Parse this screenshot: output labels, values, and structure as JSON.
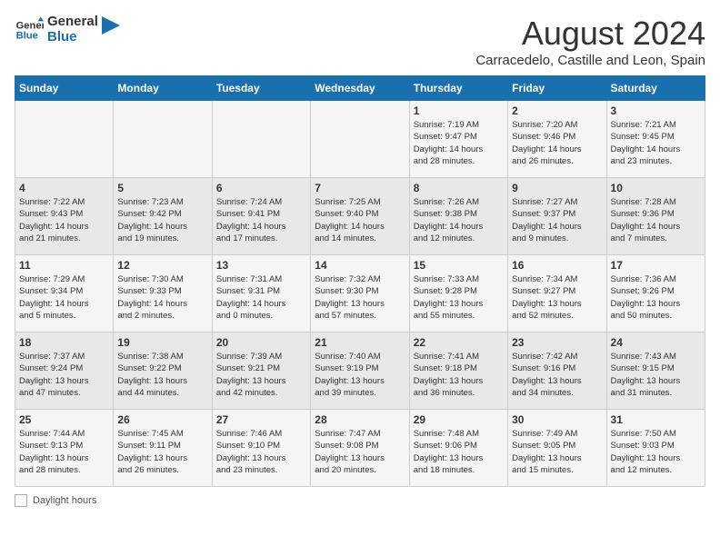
{
  "header": {
    "logo_text_general": "General",
    "logo_text_blue": "Blue",
    "month_year": "August 2024",
    "location": "Carracedelo, Castille and Leon, Spain"
  },
  "weekdays": [
    "Sunday",
    "Monday",
    "Tuesday",
    "Wednesday",
    "Thursday",
    "Friday",
    "Saturday"
  ],
  "weeks": [
    [
      {
        "day": "",
        "info": ""
      },
      {
        "day": "",
        "info": ""
      },
      {
        "day": "",
        "info": ""
      },
      {
        "day": "",
        "info": ""
      },
      {
        "day": "1",
        "info": "Sunrise: 7:19 AM\nSunset: 9:47 PM\nDaylight: 14 hours\nand 28 minutes."
      },
      {
        "day": "2",
        "info": "Sunrise: 7:20 AM\nSunset: 9:46 PM\nDaylight: 14 hours\nand 26 minutes."
      },
      {
        "day": "3",
        "info": "Sunrise: 7:21 AM\nSunset: 9:45 PM\nDaylight: 14 hours\nand 23 minutes."
      }
    ],
    [
      {
        "day": "4",
        "info": "Sunrise: 7:22 AM\nSunset: 9:43 PM\nDaylight: 14 hours\nand 21 minutes."
      },
      {
        "day": "5",
        "info": "Sunrise: 7:23 AM\nSunset: 9:42 PM\nDaylight: 14 hours\nand 19 minutes."
      },
      {
        "day": "6",
        "info": "Sunrise: 7:24 AM\nSunset: 9:41 PM\nDaylight: 14 hours\nand 17 minutes."
      },
      {
        "day": "7",
        "info": "Sunrise: 7:25 AM\nSunset: 9:40 PM\nDaylight: 14 hours\nand 14 minutes."
      },
      {
        "day": "8",
        "info": "Sunrise: 7:26 AM\nSunset: 9:38 PM\nDaylight: 14 hours\nand 12 minutes."
      },
      {
        "day": "9",
        "info": "Sunrise: 7:27 AM\nSunset: 9:37 PM\nDaylight: 14 hours\nand 9 minutes."
      },
      {
        "day": "10",
        "info": "Sunrise: 7:28 AM\nSunset: 9:36 PM\nDaylight: 14 hours\nand 7 minutes."
      }
    ],
    [
      {
        "day": "11",
        "info": "Sunrise: 7:29 AM\nSunset: 9:34 PM\nDaylight: 14 hours\nand 5 minutes."
      },
      {
        "day": "12",
        "info": "Sunrise: 7:30 AM\nSunset: 9:33 PM\nDaylight: 14 hours\nand 2 minutes."
      },
      {
        "day": "13",
        "info": "Sunrise: 7:31 AM\nSunset: 9:31 PM\nDaylight: 14 hours\nand 0 minutes."
      },
      {
        "day": "14",
        "info": "Sunrise: 7:32 AM\nSunset: 9:30 PM\nDaylight: 13 hours\nand 57 minutes."
      },
      {
        "day": "15",
        "info": "Sunrise: 7:33 AM\nSunset: 9:28 PM\nDaylight: 13 hours\nand 55 minutes."
      },
      {
        "day": "16",
        "info": "Sunrise: 7:34 AM\nSunset: 9:27 PM\nDaylight: 13 hours\nand 52 minutes."
      },
      {
        "day": "17",
        "info": "Sunrise: 7:36 AM\nSunset: 9:26 PM\nDaylight: 13 hours\nand 50 minutes."
      }
    ],
    [
      {
        "day": "18",
        "info": "Sunrise: 7:37 AM\nSunset: 9:24 PM\nDaylight: 13 hours\nand 47 minutes."
      },
      {
        "day": "19",
        "info": "Sunrise: 7:38 AM\nSunset: 9:22 PM\nDaylight: 13 hours\nand 44 minutes."
      },
      {
        "day": "20",
        "info": "Sunrise: 7:39 AM\nSunset: 9:21 PM\nDaylight: 13 hours\nand 42 minutes."
      },
      {
        "day": "21",
        "info": "Sunrise: 7:40 AM\nSunset: 9:19 PM\nDaylight: 13 hours\nand 39 minutes."
      },
      {
        "day": "22",
        "info": "Sunrise: 7:41 AM\nSunset: 9:18 PM\nDaylight: 13 hours\nand 36 minutes."
      },
      {
        "day": "23",
        "info": "Sunrise: 7:42 AM\nSunset: 9:16 PM\nDaylight: 13 hours\nand 34 minutes."
      },
      {
        "day": "24",
        "info": "Sunrise: 7:43 AM\nSunset: 9:15 PM\nDaylight: 13 hours\nand 31 minutes."
      }
    ],
    [
      {
        "day": "25",
        "info": "Sunrise: 7:44 AM\nSunset: 9:13 PM\nDaylight: 13 hours\nand 28 minutes."
      },
      {
        "day": "26",
        "info": "Sunrise: 7:45 AM\nSunset: 9:11 PM\nDaylight: 13 hours\nand 26 minutes."
      },
      {
        "day": "27",
        "info": "Sunrise: 7:46 AM\nSunset: 9:10 PM\nDaylight: 13 hours\nand 23 minutes."
      },
      {
        "day": "28",
        "info": "Sunrise: 7:47 AM\nSunset: 9:08 PM\nDaylight: 13 hours\nand 20 minutes."
      },
      {
        "day": "29",
        "info": "Sunrise: 7:48 AM\nSunset: 9:06 PM\nDaylight: 13 hours\nand 18 minutes."
      },
      {
        "day": "30",
        "info": "Sunrise: 7:49 AM\nSunset: 9:05 PM\nDaylight: 13 hours\nand 15 minutes."
      },
      {
        "day": "31",
        "info": "Sunrise: 7:50 AM\nSunset: 9:03 PM\nDaylight: 13 hours\nand 12 minutes."
      }
    ]
  ],
  "footer": {
    "daylight_label": "Daylight hours"
  }
}
